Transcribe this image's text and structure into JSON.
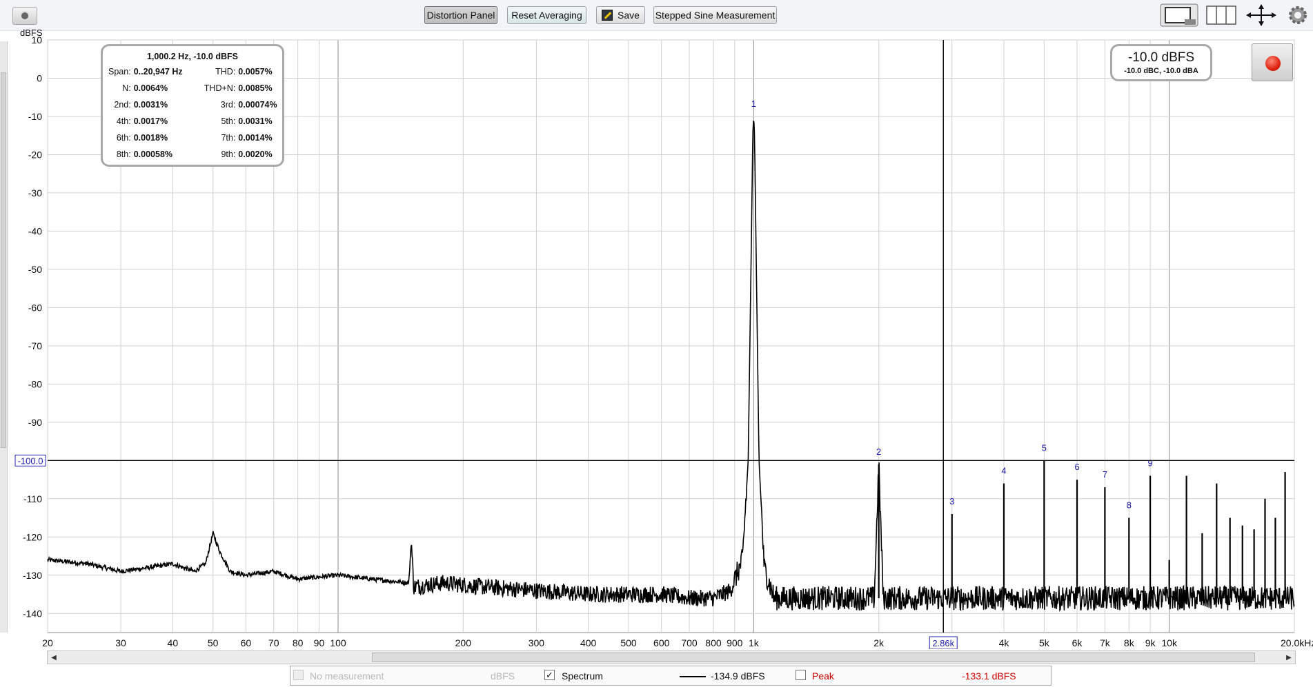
{
  "toolbar": {
    "distortion_panel": "Distortion Panel",
    "reset_averaging": "Reset Averaging",
    "save": "Save",
    "stepped_sine": "Stepped Sine Measurement"
  },
  "axis": {
    "y_unit": "dBFS",
    "y_ticks": [
      10,
      0,
      -10,
      -20,
      -30,
      -40,
      -50,
      -60,
      -70,
      -80,
      -90,
      -100,
      -110,
      -120,
      -130,
      -140
    ],
    "x_ticks": [
      {
        "f": 20,
        "label": "20"
      },
      {
        "f": 30,
        "label": "30"
      },
      {
        "f": 40,
        "label": "40"
      },
      {
        "f": 50,
        "label": "50"
      },
      {
        "f": 60,
        "label": "60"
      },
      {
        "f": 70,
        "label": "70"
      },
      {
        "f": 80,
        "label": "80"
      },
      {
        "f": 90,
        "label": "90"
      },
      {
        "f": 100,
        "label": "100"
      },
      {
        "f": 200,
        "label": "200"
      },
      {
        "f": 300,
        "label": "300"
      },
      {
        "f": 400,
        "label": "400"
      },
      {
        "f": 500,
        "label": "500"
      },
      {
        "f": 600,
        "label": "600"
      },
      {
        "f": 700,
        "label": "700"
      },
      {
        "f": 800,
        "label": "800"
      },
      {
        "f": 900,
        "label": "900"
      },
      {
        "f": 1000,
        "label": "1k"
      },
      {
        "f": 2000,
        "label": "2k"
      },
      {
        "f": 4000,
        "label": "4k"
      },
      {
        "f": 5000,
        "label": "5k"
      },
      {
        "f": 6000,
        "label": "6k"
      },
      {
        "f": 7000,
        "label": "7k"
      },
      {
        "f": 8000,
        "label": "8k"
      },
      {
        "f": 9000,
        "label": "9k"
      },
      {
        "f": 10000,
        "label": "10k"
      },
      {
        "f": 20000,
        "label": "20.0kHz"
      }
    ],
    "cursor_level_label": "-100.0",
    "cursor_freq_label": "2.86k"
  },
  "stats": {
    "header": "1,000.2 Hz, -10.0 dBFS",
    "rows": [
      [
        {
          "k": "Span:",
          "v": "0..20,947 Hz"
        },
        {
          "k": "THD:",
          "v": "0.0057%"
        }
      ],
      [
        {
          "k": "N:",
          "v": "0.0064%"
        },
        {
          "k": "THD+N:",
          "v": "0.0085%"
        }
      ],
      [
        {
          "k": "2nd:",
          "v": "0.0031%"
        },
        {
          "k": "3rd:",
          "v": "0.00074%"
        }
      ],
      [
        {
          "k": "4th:",
          "v": "0.0017%"
        },
        {
          "k": "5th:",
          "v": "0.0031%"
        }
      ],
      [
        {
          "k": "6th:",
          "v": "0.0018%"
        },
        {
          "k": "7th:",
          "v": "0.0014%"
        }
      ],
      [
        {
          "k": "8th:",
          "v": "0.00058%"
        },
        {
          "k": "9th:",
          "v": "0.0020%"
        }
      ]
    ]
  },
  "level": {
    "main": "-10.0 dBFS",
    "sub": "-10.0 dBC, -10.0 dBA"
  },
  "legend": {
    "no_measurement": "No measurement",
    "no_measurement_unit": "dBFS",
    "spectrum": "Spectrum",
    "spectrum_value": "-134.9 dBFS",
    "peak": "Peak",
    "peak_value": "-133.1 dBFS",
    "peak_color": "#d00000"
  },
  "chart_data": {
    "type": "line",
    "xlabel": "",
    "ylabel": "dBFS",
    "xscale": "log",
    "xlim": [
      20,
      20000
    ],
    "ylim": [
      -145,
      10
    ],
    "grid": true,
    "series": [
      {
        "name": "Spectrum",
        "color": "#000000",
        "x": [
          20,
          25,
          30,
          35,
          40,
          45,
          48,
          50,
          52,
          55,
          60,
          70,
          80,
          100,
          120,
          148,
          150,
          152,
          180,
          220,
          300,
          400,
          500,
          600,
          700,
          800,
          880,
          940,
          970,
          985,
          995,
          1000,
          1005,
          1015,
          1030,
          1060,
          1120,
          1300,
          1500,
          1700,
          1950,
          2000,
          2050,
          2400,
          2860,
          3000,
          3500,
          4000,
          4500,
          5000,
          6000,
          7000,
          8000,
          9000,
          10000,
          12000,
          15000,
          18000,
          20000
        ],
        "y": [
          -126,
          -127,
          -129,
          -128,
          -127,
          -129,
          -127,
          -119,
          -124,
          -129,
          -130,
          -129,
          -131,
          -130,
          -131,
          -132,
          -121,
          -133,
          -132,
          -133,
          -134,
          -135,
          -135,
          -135,
          -136,
          -136,
          -134,
          -126,
          -100,
          -50,
          -15,
          -10,
          -15,
          -50,
          -100,
          -128,
          -136,
          -136,
          -136,
          -136,
          -136,
          -101,
          -136,
          -136,
          -136,
          -136,
          -136,
          -136,
          -136,
          -136,
          -136,
          -136,
          -136,
          -136,
          -136,
          -136,
          -136,
          -136,
          -136
        ]
      }
    ],
    "harmonics": [
      {
        "label": "1",
        "f": 1000,
        "db": -10
      },
      {
        "label": "2",
        "f": 2000,
        "db": -101
      },
      {
        "label": "3",
        "f": 3000,
        "db": -114
      },
      {
        "label": "4",
        "f": 4000,
        "db": -106
      },
      {
        "label": "5",
        "f": 5000,
        "db": -100
      },
      {
        "label": "6",
        "f": 6000,
        "db": -105
      },
      {
        "label": "7",
        "f": 7000,
        "db": -107
      },
      {
        "label": "8",
        "f": 8000,
        "db": -115
      },
      {
        "label": "9",
        "f": 9000,
        "db": -104
      }
    ],
    "extra_spurs": [
      {
        "f": 10000,
        "db": -126
      },
      {
        "f": 11000,
        "db": -104
      },
      {
        "f": 12000,
        "db": -119
      },
      {
        "f": 13000,
        "db": -106
      },
      {
        "f": 14000,
        "db": -115
      },
      {
        "f": 15000,
        "db": -117
      },
      {
        "f": 16000,
        "db": -118
      },
      {
        "f": 17000,
        "db": -110
      },
      {
        "f": 18000,
        "db": -115
      },
      {
        "f": 19000,
        "db": -103
      }
    ]
  }
}
